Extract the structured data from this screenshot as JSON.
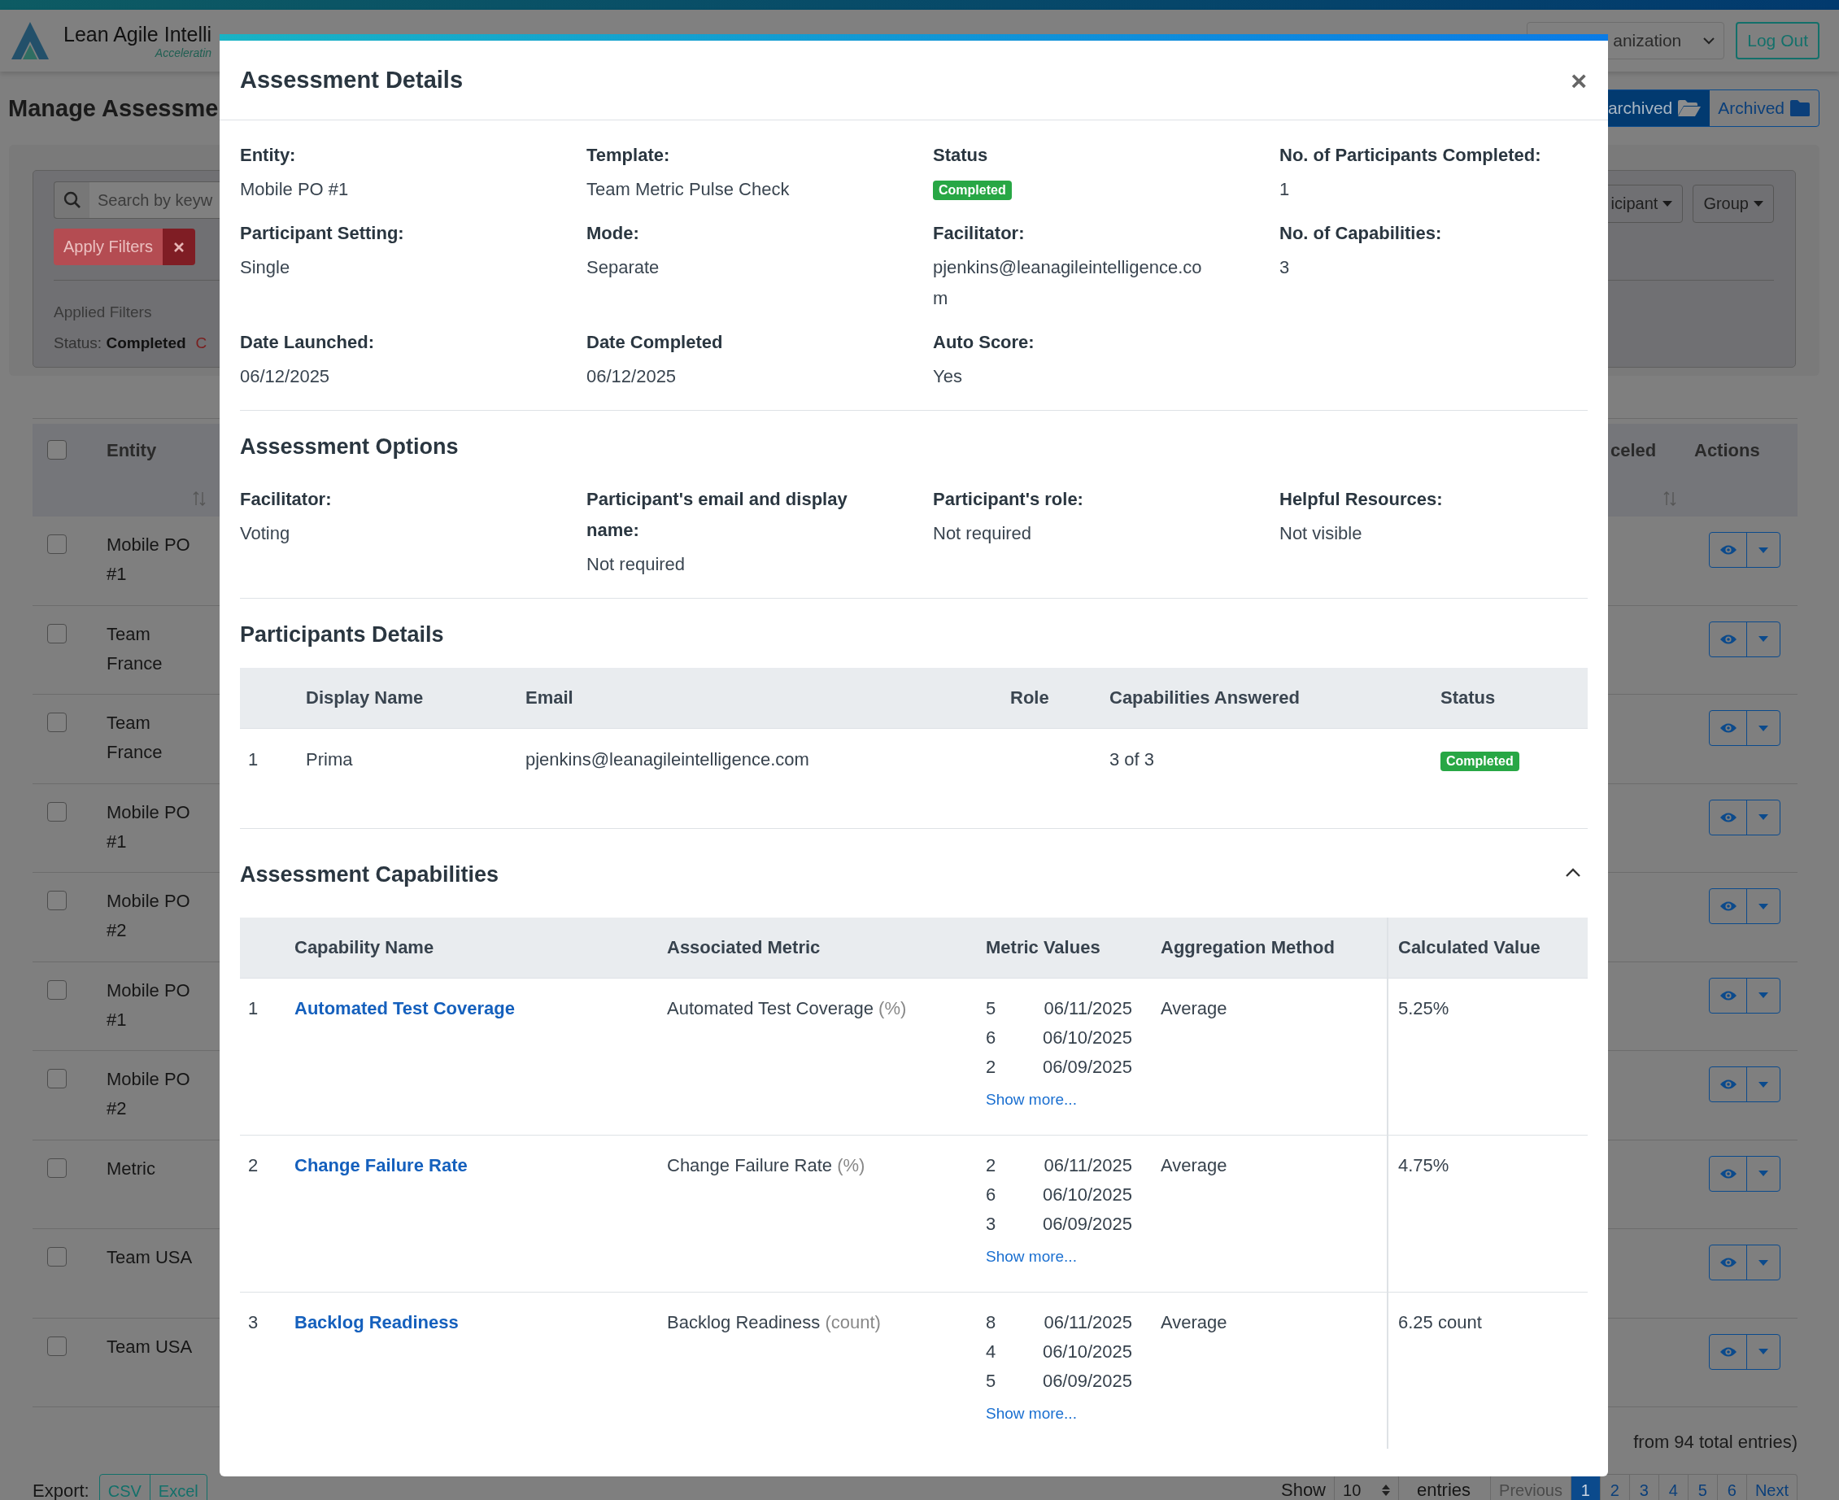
{
  "app_header": {
    "brand": "Lean Agile Intelli",
    "tagline": "Acceleratin",
    "organization_select": "anization",
    "logout": "Log Out"
  },
  "page": {
    "title": "Manage Assessme",
    "view_toggle": [
      {
        "label": "archived",
        "selected": true
      },
      {
        "label": "Archived",
        "selected": false
      }
    ]
  },
  "filters": {
    "search_placeholder": "Search by keyw",
    "apply_button": "Apply Filters",
    "dropdowns": [
      "icipant",
      "Group"
    ],
    "applied_heading": "Applied Filters",
    "applied": [
      {
        "key": "Status:",
        "value": "Completed"
      }
    ],
    "clear_link": "C"
  },
  "table": {
    "columns": [
      "Entity",
      "celed",
      "Actions"
    ],
    "select_all_checked": false,
    "rows": [
      {
        "entity": "Mobile PO #1",
        "checked": false
      },
      {
        "entity": "Team France",
        "checked": false
      },
      {
        "entity": "Team France",
        "checked": false
      },
      {
        "entity": "Mobile PO #1",
        "checked": false
      },
      {
        "entity": "Mobile PO #2",
        "checked": false
      },
      {
        "entity": "Mobile PO #1",
        "checked": false
      },
      {
        "entity": "Mobile PO #2",
        "checked": false
      },
      {
        "entity": "Metric",
        "checked": false
      },
      {
        "entity": "Team USA",
        "checked": false
      },
      {
        "entity": "Team USA",
        "checked": false
      }
    ]
  },
  "footer": {
    "summary": "from 94 total entries)",
    "export_label": "Export:",
    "export_buttons": [
      "CSV",
      "Excel"
    ],
    "show_label": "Show",
    "page_size": "10",
    "entries_label": "entries",
    "pagination": [
      {
        "label": "Previous",
        "selected": false,
        "disabled": true
      },
      {
        "label": "1",
        "selected": true,
        "disabled": false
      },
      {
        "label": "2",
        "selected": false,
        "disabled": false
      },
      {
        "label": "3",
        "selected": false,
        "disabled": false
      },
      {
        "label": "4",
        "selected": false,
        "disabled": false
      },
      {
        "label": "5",
        "selected": false,
        "disabled": false
      },
      {
        "label": "6",
        "selected": false,
        "disabled": false
      },
      {
        "label": "Next",
        "selected": false,
        "disabled": false
      }
    ]
  },
  "modal": {
    "title": "Assessment Details",
    "close_label": "×",
    "details": [
      {
        "label": "Entity:",
        "value": "Mobile PO #1",
        "kind": "text"
      },
      {
        "label": "Template:",
        "value": "Team Metric Pulse Check",
        "kind": "text"
      },
      {
        "label": "Status",
        "value": "Completed",
        "kind": "badge"
      },
      {
        "label": "No. of Participants Completed:",
        "value": "1",
        "kind": "text"
      },
      {
        "label": "Participant Setting:",
        "value": "Single",
        "kind": "text"
      },
      {
        "label": "Mode:",
        "value": "Separate",
        "kind": "text"
      },
      {
        "label": "Facilitator:",
        "value": "pjenkins@leanagileintelligence.com",
        "kind": "text"
      },
      {
        "label": "No. of Capabilities:",
        "value": "3",
        "kind": "text"
      },
      {
        "label": "Date Launched:",
        "value": "06/12/2025",
        "kind": "text"
      },
      {
        "label": "Date Completed",
        "value": "06/12/2025",
        "kind": "text"
      },
      {
        "label": "Auto Score:",
        "value": "Yes",
        "kind": "text"
      }
    ],
    "options": {
      "title": "Assessment Options",
      "items": [
        {
          "label": "Facilitator:",
          "value": "Voting"
        },
        {
          "label": "Participant's email and display name:",
          "value": "Not required"
        },
        {
          "label": "Participant's role:",
          "value": "Not required"
        },
        {
          "label": "Helpful Resources:",
          "value": "Not visible"
        }
      ]
    },
    "participants": {
      "title": "Participants Details",
      "columns": [
        "Display Name",
        "Email",
        "Role",
        "Capabilities Answered",
        "Status"
      ],
      "rows": [
        {
          "index": "1",
          "display_name": "Prima",
          "email": "pjenkins@leanagileintelligence.com",
          "capabilities_answered": "3 of 3",
          "status": "Completed"
        }
      ]
    },
    "capabilities": {
      "title": "Assessment Capabilities",
      "expanded": true,
      "columns": [
        "Capability Name",
        "Associated Metric",
        "Metric Values",
        "Aggregation Method",
        "Calculated Value"
      ],
      "rows": [
        {
          "index": "1",
          "name": "Automated Test Coverage",
          "metric": "Automated Test Coverage",
          "unit": "(%)",
          "values": [
            {
              "value": "5",
              "date": "06/11/2025"
            },
            {
              "value": "6",
              "date": "06/10/2025"
            },
            {
              "value": "2",
              "date": "06/09/2025"
            }
          ],
          "more": "Show more...",
          "aggregation": "Average",
          "calculated": "5.25%"
        },
        {
          "index": "2",
          "name": "Change Failure Rate",
          "metric": "Change Failure Rate",
          "unit": "(%)",
          "values": [
            {
              "value": "2",
              "date": "06/11/2025"
            },
            {
              "value": "6",
              "date": "06/10/2025"
            },
            {
              "value": "3",
              "date": "06/09/2025"
            }
          ],
          "more": "Show more...",
          "aggregation": "Average",
          "calculated": "4.75%"
        },
        {
          "index": "3",
          "name": "Backlog Readiness",
          "metric": "Backlog Readiness",
          "unit": "(count)",
          "values": [
            {
              "value": "8",
              "date": "06/11/2025"
            },
            {
              "value": "4",
              "date": "06/10/2025"
            },
            {
              "value": "5",
              "date": "06/09/2025"
            }
          ],
          "more": "Show more...",
          "aggregation": "Average",
          "calculated": "6.25 count"
        }
      ]
    }
  }
}
